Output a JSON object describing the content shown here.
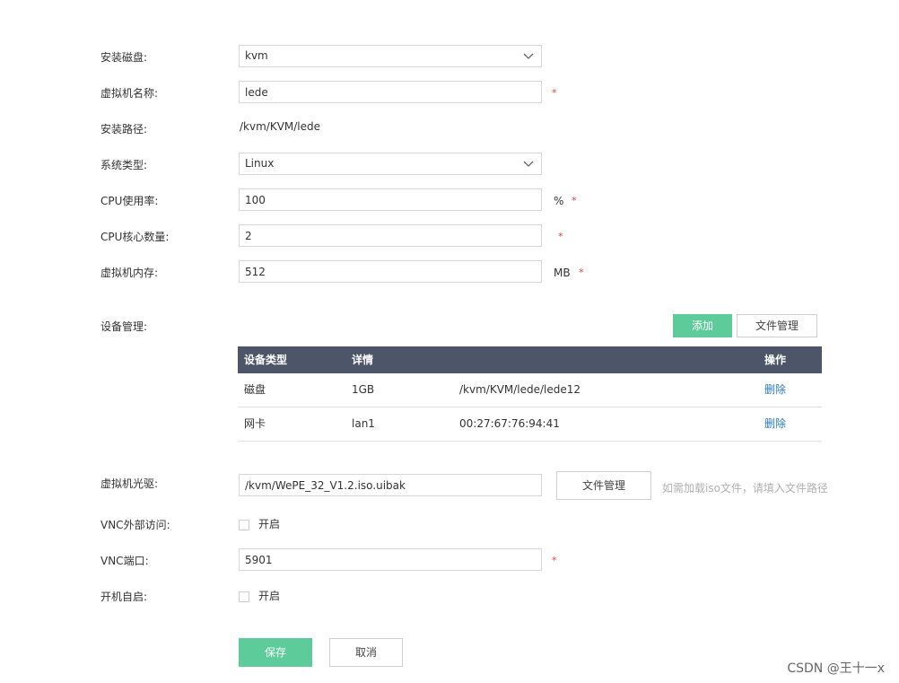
{
  "form": {
    "install_disk": {
      "label": "安装磁盘:",
      "value": "kvm"
    },
    "vm_name": {
      "label": "虚拟机名称:",
      "value": "lede",
      "required": "*"
    },
    "install_path": {
      "label": "安装路径:",
      "value": "/kvm/KVM/lede"
    },
    "os_type": {
      "label": "系统类型:",
      "value": "Linux"
    },
    "cpu_usage": {
      "label": "CPU使用率:",
      "value": "100",
      "unit": "%",
      "required": "*"
    },
    "cpu_cores": {
      "label": "CPU核心数量:",
      "value": "2",
      "required": "*"
    },
    "memory": {
      "label": "虚拟机内存:",
      "value": "512",
      "unit": "MB",
      "required": "*"
    }
  },
  "devices": {
    "label": "设备管理:",
    "add_button": "添加",
    "file_manage_button": "文件管理",
    "columns": {
      "type": "设备类型",
      "detail": "详情",
      "action": "操作"
    },
    "rows": [
      {
        "type": "磁盘",
        "detail": "1GB",
        "extra": "/kvm/KVM/lede/lede12",
        "action": "删除"
      },
      {
        "type": "网卡",
        "detail": "lan1",
        "extra": "00:27:67:76:94:41",
        "action": "删除"
      }
    ]
  },
  "cdrom": {
    "label": "虚拟机光驱:",
    "value": "/kvm/WePE_32_V1.2.iso.uibak",
    "file_manage_button": "文件管理",
    "hint": "如需加载iso文件，请填入文件路径"
  },
  "vnc_external": {
    "label": "VNC外部访问:",
    "checkbox_label": "开启",
    "checked": false
  },
  "vnc_port": {
    "label": "VNC端口:",
    "value": "5901",
    "required": "*"
  },
  "autostart": {
    "label": "开机自启:",
    "checkbox_label": "开启",
    "checked": false
  },
  "actions": {
    "save": "保存",
    "cancel": "取消"
  },
  "watermark": "CSDN @王十一x",
  "colors": {
    "accent": "#5ecb9a",
    "table_header": "#4d5568",
    "link": "#2b7cc7",
    "required": "#e0453c"
  }
}
